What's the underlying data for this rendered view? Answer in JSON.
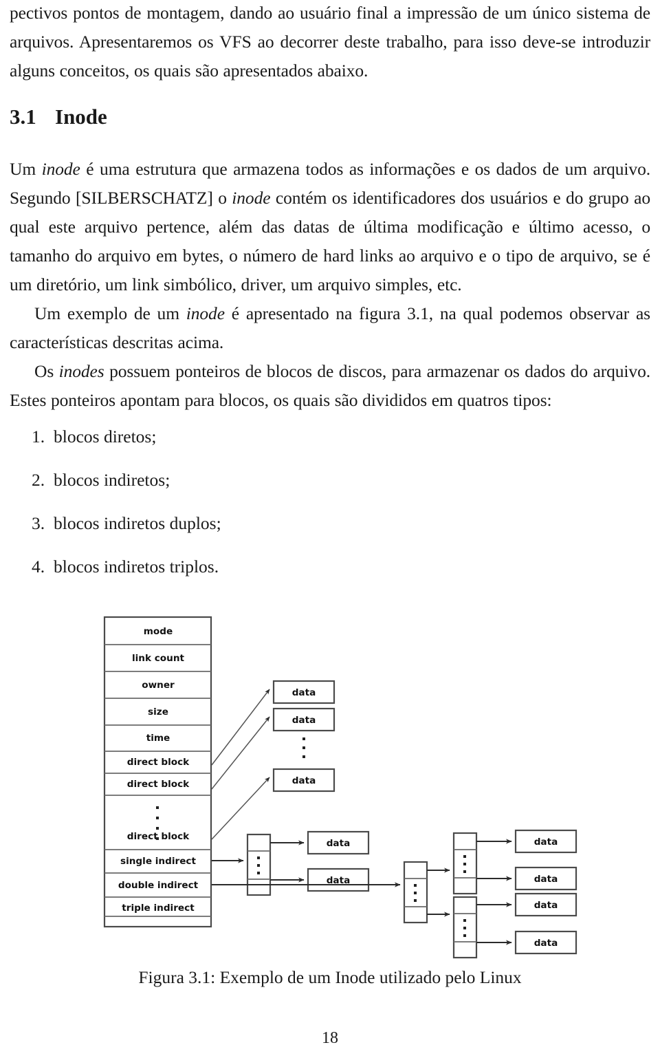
{
  "document": {
    "page_number": "18",
    "paragraphs": [
      {
        "id": "p-intro",
        "text": "pectivos pontos de montagem, dando ao usuário final a impressão de um único sistema de arquivos. Apresentaremos os VFS ao decorrer deste trabalho, para isso deve-se introduzir alguns conceitos, os quais são apresentados abaixo."
      }
    ],
    "section": {
      "number": "3.1",
      "title": "Inode"
    },
    "paragraph_inode_1": {
      "seg1": "Um ",
      "em1": "inode",
      "seg2": " é uma estrutura que armazena todos as informações e os dados de um arquivo. Segundo [SILBERSCHATZ] o ",
      "em2": "inode",
      "seg3": " contém os identificadores dos usuários e do grupo ao qual este arquivo pertence, além das datas de última modificação e último acesso, o tamanho do arquivo em bytes, o número de hard links ao arquivo e o tipo de arquivo, se é um diretório, um link simbólico, driver, um arquivo simples, etc."
    },
    "paragraph_inode_2": {
      "seg1": "Um exemplo de um ",
      "em1": "inode",
      "seg2": " é apresentado na figura 3.1, na qual podemos observar as características descritas acima."
    },
    "paragraph_inode_3": {
      "seg1": "Os ",
      "em1": "inodes",
      "seg2": " possuem ponteiros de blocos de discos, para armazenar os dados do arquivo. Estes ponteiros apontam para blocos, os quais são divididos em quatros tipos:"
    },
    "list": [
      {
        "marker": "1.",
        "text": "blocos diretos;"
      },
      {
        "marker": "2.",
        "text": "blocos indiretos;"
      },
      {
        "marker": "3.",
        "text": "blocos indiretos duplos;"
      },
      {
        "marker": "4.",
        "text": "blocos indiretos triplos."
      }
    ],
    "figure": {
      "caption": "Figura 3.1: Exemplo de um Inode utilizado pelo Linux",
      "inode_rows": [
        "mode",
        "link count",
        "owner",
        "size",
        "time",
        "direct block",
        "direct block",
        "",
        "direct block",
        "single indirect",
        "double indirect",
        "triple indirect"
      ],
      "data_block_label": "data",
      "data_blocks_direct": [
        "data",
        "data",
        "data"
      ],
      "data_blocks_single_indirect": [
        "data",
        "data"
      ],
      "data_blocks_triple_group_a": [
        "data",
        "data"
      ],
      "data_blocks_triple_group_b": [
        "data",
        "data"
      ],
      "colors": {
        "box_stroke": "#4a4a4a",
        "row_stroke": "#6a6a6a",
        "arrow": "#2b2b2b",
        "text": "#111111",
        "background": "#ffffff"
      }
    }
  }
}
